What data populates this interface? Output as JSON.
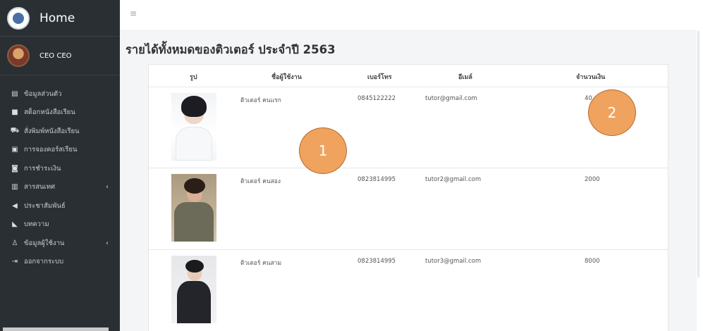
{
  "sidebar": {
    "brand": "Home",
    "user_name": "CEO CEO",
    "items": [
      {
        "label": "ข้อมูลส่วนตัว",
        "icon": "id-card-icon",
        "glyph": "▤",
        "has_submenu": false
      },
      {
        "label": "สต็อกหนังสือเรียน",
        "icon": "stock-icon",
        "glyph": "■",
        "has_submenu": false
      },
      {
        "label": "สั่งพิมพ์หนังสือเรียน",
        "icon": "cart-icon",
        "glyph": "⛟",
        "has_submenu": false
      },
      {
        "label": "การจองคอร์สเรียน",
        "icon": "document-icon",
        "glyph": "▣",
        "has_submenu": false
      },
      {
        "label": "การชำระเงิน",
        "icon": "money-icon",
        "glyph": "◙",
        "has_submenu": false
      },
      {
        "label": "สารสนเทศ",
        "icon": "bar-chart-icon",
        "glyph": "▥",
        "has_submenu": true
      },
      {
        "label": "ประชาสัมพันธ์",
        "icon": "megaphone-icon",
        "glyph": "◀",
        "has_submenu": false
      },
      {
        "label": "บทความ",
        "icon": "rss-icon",
        "glyph": "◣",
        "has_submenu": false
      },
      {
        "label": "ข้อมูลผู้ใช้งาน",
        "icon": "user-icon",
        "glyph": "♙",
        "has_submenu": true
      },
      {
        "label": "ออกจากระบบ",
        "icon": "logout-icon",
        "glyph": "⇥",
        "has_submenu": false
      }
    ],
    "chevron": "‹"
  },
  "topbar": {
    "menu_icon": "≡"
  },
  "page": {
    "title": "รายได้ทั้งหมดของติวเตอร์ ประจำปี 2563"
  },
  "table": {
    "headers": {
      "photo": "รูป",
      "username": "ชื่อผู้ใช้งาน",
      "phone": "เบอร์โทร",
      "email": "อีเมล์",
      "amount": "จำนวนเงิน"
    },
    "rows": [
      {
        "username": "ติวเตอร์ คนแรก",
        "phone": "0845122222",
        "email": "tutor@gmail.com",
        "amount": "40"
      },
      {
        "username": "ติวเตอร์ คนสอง",
        "phone": "0823814995",
        "email": "tutor2@gmail.com",
        "amount": "2000"
      },
      {
        "username": "ติวเตอร์ คนสาม",
        "phone": "0823814995",
        "email": "tutor3@gmail.com",
        "amount": "8000"
      }
    ]
  },
  "annotations": [
    {
      "label": "1"
    },
    {
      "label": "2"
    }
  ],
  "colors": {
    "sidebar_bg": "#2a2f33",
    "annotation_fill": "#f0a35e",
    "annotation_border": "#b56a2c"
  }
}
